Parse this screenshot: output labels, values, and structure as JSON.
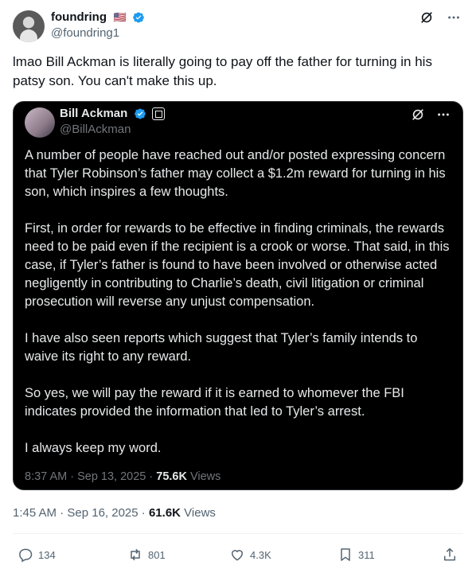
{
  "author": {
    "display_name": "foundring",
    "flag": "🇺🇸",
    "handle": "@foundring1"
  },
  "post": {
    "text": "lmao Bill Ackman is literally going to pay off the father for turning in his patsy son. You can't make this up.",
    "timestamp": "1:45 AM · Sep 16, 2025",
    "views_count": "61.6K",
    "views_label": "Views"
  },
  "quoted": {
    "display_name": "Bill Ackman",
    "handle": "@BillAckman",
    "paragraphs": [
      "A number of people have reached out and/or posted expressing concern that Tyler Robinson’s father may collect a $1.2m reward for turning in his son, which inspires a few thoughts.",
      "First, in order for rewards to be effective in finding criminals, the rewards need to be paid even if the recipient is a crook or worse. That said, in this case, if Tyler’s father is found to have been involved or otherwise acted negligently in contributing to Charlie’s death, civil litigation or criminal prosecution will reverse any unjust compensation.",
      "I have also seen reports which suggest that Tyler’s family intends to waive its right to any reward.",
      "So yes, we will pay the reward if it is earned to whomever the FBI indicates provided the information that led to Tyler’s arrest.",
      "I always keep my word."
    ],
    "timestamp": "8:37 AM · Sep 13, 2025 · ",
    "views_count": "75.6K",
    "views_label": "Views"
  },
  "actions": {
    "replies": "134",
    "reposts": "801",
    "likes": "4.3K",
    "bookmarks": "311"
  },
  "icons": {
    "verified": "verified-badge-icon",
    "grok": "grok-icon",
    "more": "more-icon",
    "reply": "reply-icon",
    "repost": "repost-icon",
    "like": "like-icon",
    "bookmark": "bookmark-icon",
    "share": "share-icon"
  },
  "colors": {
    "accent": "#1d9bf0",
    "text_primary": "#0f1419",
    "text_secondary": "#536471",
    "quote_bg": "#000000"
  }
}
